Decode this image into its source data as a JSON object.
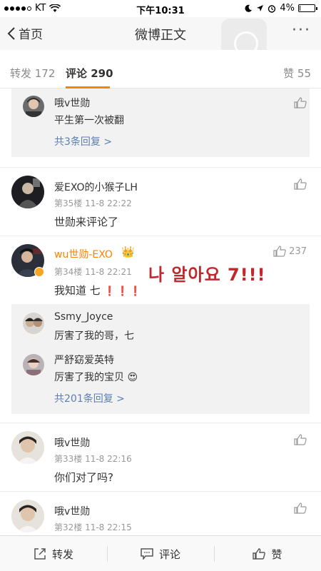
{
  "status_bar": {
    "carrier": "KT",
    "time": "下午10:31",
    "battery": "4%",
    "battery_level": 0.04,
    "icons": [
      "signal-dots",
      "wifi-icon",
      "moon-icon",
      "location-icon",
      "alarm-icon",
      "battery-icon"
    ]
  },
  "nav": {
    "back_label": "首页",
    "title": "微博正文",
    "more": "···"
  },
  "tabs": {
    "repost": "转发 172",
    "comment": "评论 290",
    "like": "赞 55",
    "accent_color": "#ff8200"
  },
  "comments": [
    {
      "reply_name": "哦v世勋",
      "reply_text": "平生第一次被翻",
      "more": "共3条回复 >"
    },
    {
      "name": "爱EXO的小猴子LH",
      "meta": "第35楼 11-8 22:22",
      "text": "世勋来评论了"
    },
    {
      "name": "wu世勋-EXO",
      "meta": "第34楼 11-8 22:21",
      "text": "我知道 七",
      "exclaims": "❗❗❗",
      "likes": "237",
      "overlay": "나 알아요 7!!!",
      "replies": [
        {
          "name": "Ssmy_Joyce",
          "text": "厉害了我的哥，七"
        },
        {
          "name": "严舒窈爱英特",
          "text": "厉害了我的宝贝"
        }
      ],
      "more": "共201条回复 >"
    },
    {
      "name": "哦v世勋",
      "meta": "第33楼 11-8 22:16",
      "text": "你们对了吗?"
    },
    {
      "name": "哦v世勋",
      "meta": "第32楼 11-8 22:15"
    }
  ],
  "bottom_bar": {
    "repost": "转发",
    "comment": "评论",
    "like": "赞"
  },
  "colors": {
    "link": "#5b7fb3",
    "highlight_name": "#ff8200",
    "overlay_red": "#c0282e"
  }
}
